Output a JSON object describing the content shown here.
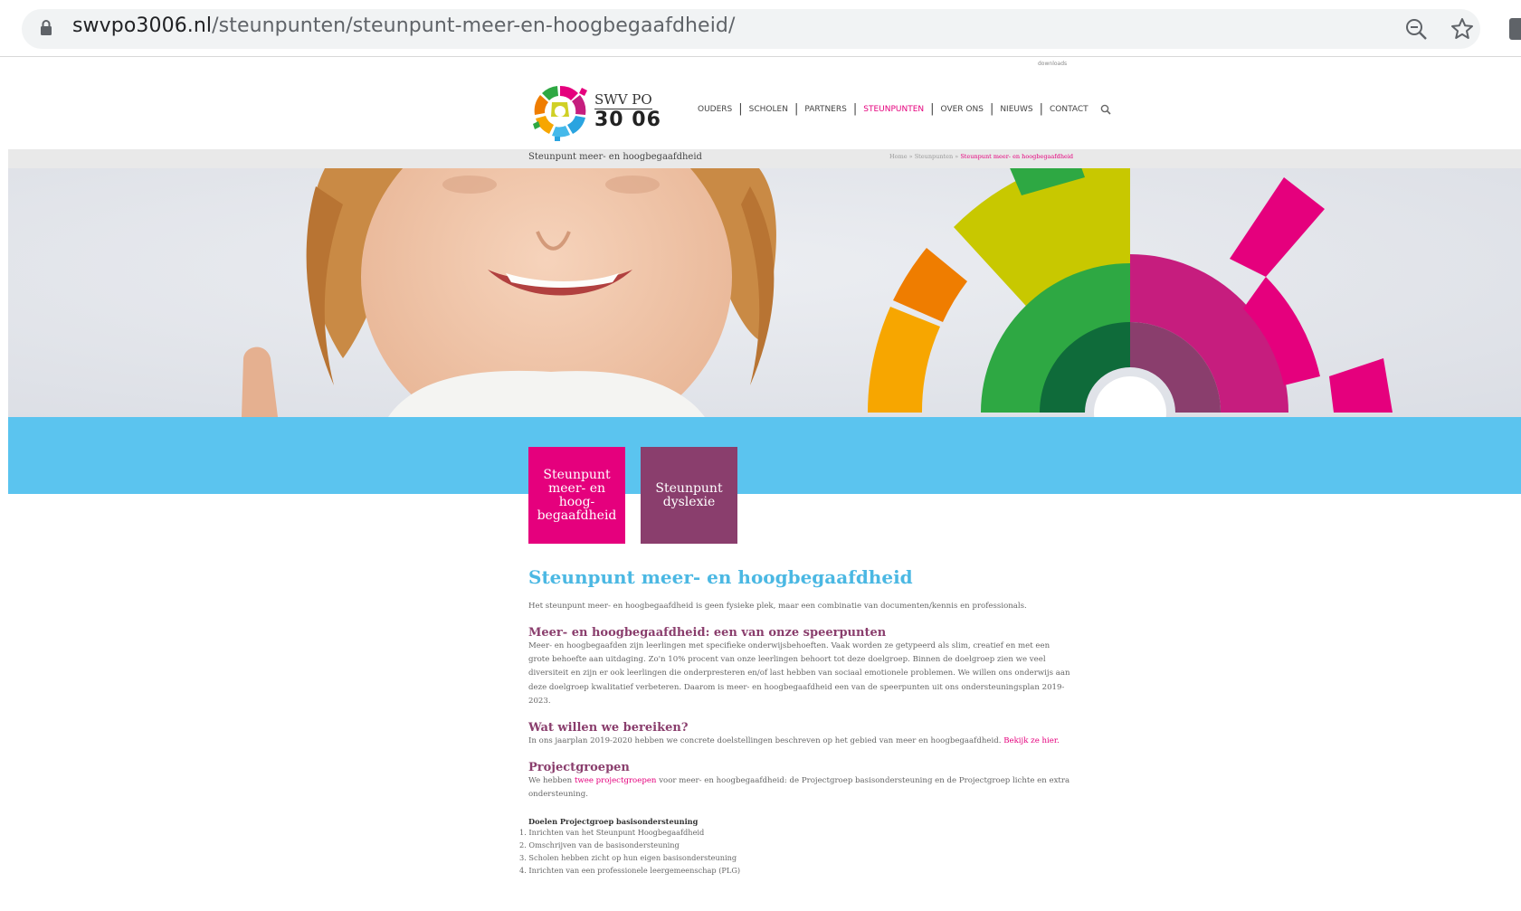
{
  "browser": {
    "url_domain": "swvpo3006.nl",
    "url_path": "/steunpunten/steunpunt-meer-en-hoogbegaafdheid/"
  },
  "header": {
    "downloads_label": "downloads",
    "logo_line1": "SWV PO",
    "logo_line2": "30 06",
    "nav": [
      "OUDERS",
      "SCHOLEN",
      "PARTNERS",
      "STEUNPUNTEN",
      "OVER ONS",
      "NIEUWS",
      "CONTACT"
    ],
    "nav_active": "STEUNPUNTEN"
  },
  "breadcrumb_bar": {
    "page_title": "Steunpunt meer- en hoogbegaafdheid",
    "crumbs": [
      "Home",
      "Steunpunten",
      "Steunpunt meer- en hoogbegaafdheid"
    ],
    "separator": "»"
  },
  "tiles": [
    {
      "label": "Steunpunt meer- en hoog- begaafdheid",
      "color": "#e5007d"
    },
    {
      "label": "Steunpunt dyslexie",
      "color": "#8a3e6d"
    }
  ],
  "content": {
    "title": "Steunpunt meer- en hoogbegaafdheid",
    "intro": "Het steunpunt meer- en hoogbegaafdheid is geen fysieke plek, maar een combinatie van documenten/kennis en professionals.",
    "section1": {
      "heading": "Meer- en hoogbegaafdheid: een van onze speerpunten",
      "text": "Meer- en hoogbegaafden zijn leerlingen met specifieke onderwijsbehoeften. Vaak worden ze getypeerd als slim, creatief en met een grote behoefte aan uitdaging. Zo'n 10% procent van onze leerlingen behoort tot deze doelgroep. Binnen de doelgroep zien we veel diversiteit en zijn er ook leerlingen die onderpresteren en/of last hebben van sociaal emotionele problemen. We willen ons onderwijs aan deze doelgroep kwalitatief verbeteren. Daarom is meer- en hoogbegaafdheid een van de speerpunten uit ons ondersteuningsplan 2019-2023."
    },
    "section2": {
      "heading": "Wat willen we bereiken?",
      "text": "In ons jaarplan 2019-2020 hebben we concrete doelstellingen beschreven op het gebied van meer en hoogbegaafdheid.",
      "link": "Bekijk ze hier."
    },
    "section3": {
      "heading": "Projectgroepen",
      "text_before": "We hebben",
      "link": "twee projectgroepen",
      "text_after": "voor meer- en hoogbegaafdheid: de Projectgroep basisondersteuning en de Projectgroep lichte en extra ondersteuning."
    },
    "goals": {
      "heading": "Doelen Projectgroep basisondersteuning",
      "items": [
        "1. Inrichten van het Steunpunt Hoogbegaafdheid",
        "2. Omschrijven van de basisondersteuning",
        "3. Scholen hebben zicht op hun eigen basisondersteuning",
        "4. Inrichten van een professionele leergemeenschap (PLG)"
      ]
    }
  },
  "colors": {
    "pink": "#e5007d",
    "purple": "#8a3e6d",
    "blue": "#5bc4ef",
    "title_blue": "#4bb8e3"
  }
}
